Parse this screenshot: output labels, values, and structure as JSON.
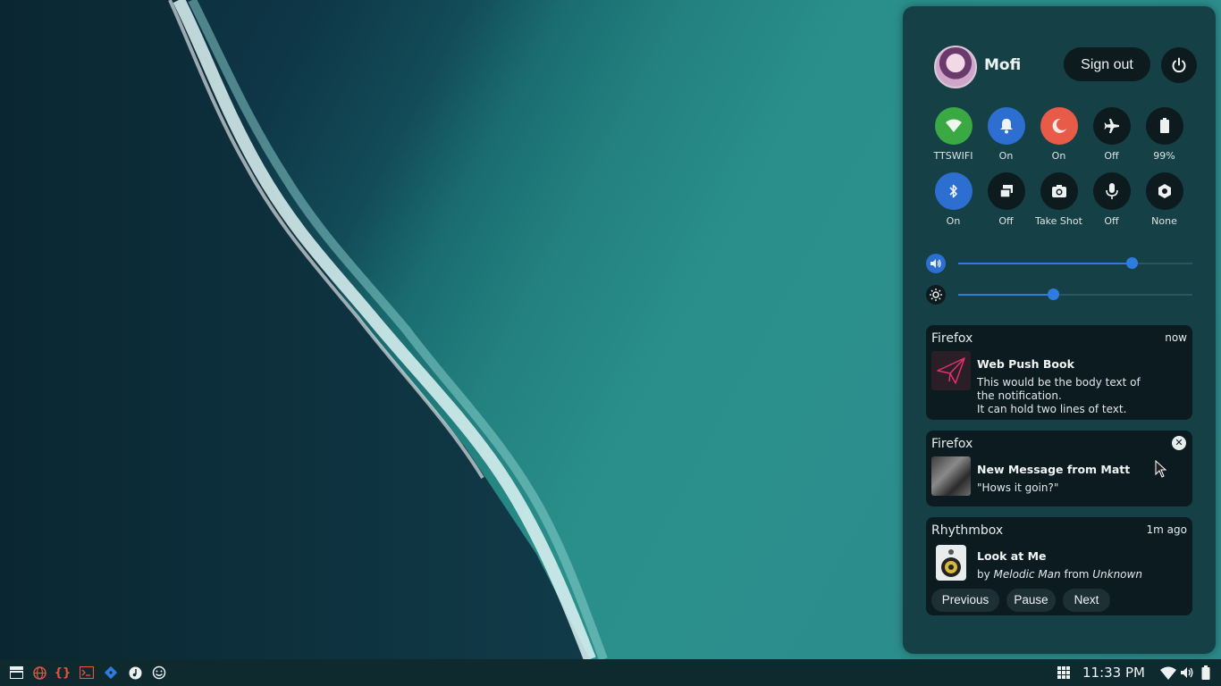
{
  "user": {
    "name": "Mofi",
    "signout_label": "Sign out"
  },
  "toggles": [
    {
      "icon": "wifi-icon",
      "label": "TTSWIFI",
      "color": "#3aa843"
    },
    {
      "icon": "bell-icon",
      "label": "On",
      "color": "#2c6fd0"
    },
    {
      "icon": "moon-icon",
      "label": "On",
      "color": "#e85b48"
    },
    {
      "icon": "airplane-icon",
      "label": "Off",
      "color": "#0d1a1e"
    },
    {
      "icon": "battery-icon",
      "label": "99%",
      "color": "#0d1a1e"
    },
    {
      "icon": "bluetooth-icon",
      "label": "On",
      "color": "#2c6fd0"
    },
    {
      "icon": "windows-icon",
      "label": "Off",
      "color": "#0d1a1e"
    },
    {
      "icon": "camera-icon",
      "label": "Take Shot",
      "color": "#0d1a1e"
    },
    {
      "icon": "microphone-icon",
      "label": "Off",
      "color": "#0d1a1e"
    },
    {
      "icon": "settings-icon",
      "label": "None",
      "color": "#0d1a1e"
    }
  ],
  "sliders": {
    "volume": {
      "icon": "volume-icon",
      "level": 0.74
    },
    "brightness": {
      "icon": "brightness-icon",
      "level": 0.405
    }
  },
  "notifications": [
    {
      "app": "Firefox",
      "time": "now",
      "icon": "paper-plane-icon",
      "title": "Web Push Book",
      "body_lines": [
        "This would be the body text of",
        "the notification.",
        "It can hold two lines of text."
      ]
    },
    {
      "app": "Firefox",
      "icon": "photo-thumbnail",
      "title": "New Message from Matt",
      "body_lines": [
        "\"Hows it goin?\""
      ]
    },
    {
      "app": "Rhythmbox",
      "time": "1m ago",
      "icon": "speaker-icon",
      "title": "Look at Me",
      "body": {
        "by": "by",
        "artist": "Melodic Man",
        "from": "from",
        "album": "Unknown"
      },
      "actions": [
        "Previous",
        "Pause",
        "Next"
      ]
    }
  ],
  "taskbar": {
    "left_icons": [
      "workspace-icon",
      "web-browser-icon",
      "code-editor-icon",
      "terminal-icon",
      "git-icon",
      "music-icon",
      "emoji-icon"
    ],
    "clock": "11:33 PM",
    "right_icons": [
      "apps-grid-icon",
      "wifi-icon",
      "volume-icon",
      "battery-icon"
    ]
  },
  "colors": {
    "accent": "#2f7ce0",
    "panel": "#143a40",
    "card": "#0c1b20"
  }
}
